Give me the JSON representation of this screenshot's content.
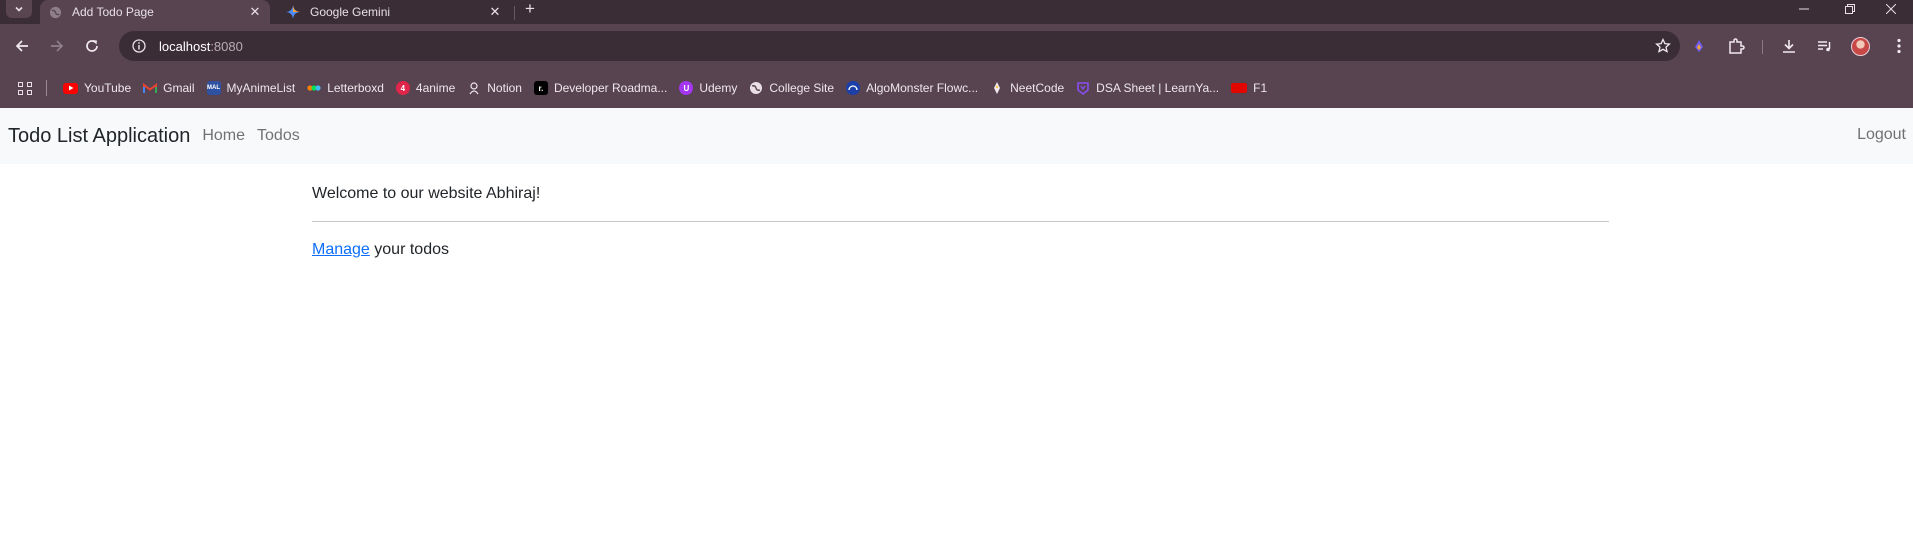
{
  "browser": {
    "tabs": [
      {
        "title": "Add Todo Page",
        "icon": "globe-icon",
        "active": true
      },
      {
        "title": "Google Gemini",
        "icon": "gemini-icon",
        "active": false
      }
    ],
    "address": {
      "host": "localhost",
      "port": ":8080"
    },
    "bookmarks": [
      {
        "label": "YouTube",
        "icon": "youtube-icon",
        "color": "#ff0000"
      },
      {
        "label": "Gmail",
        "icon": "gmail-icon",
        "color": "#ea4335"
      },
      {
        "label": "MyAnimeList",
        "icon": "myanimelist-icon",
        "color": "#2e51a2",
        "glyph": "MAL"
      },
      {
        "label": "Letterboxd",
        "icon": "letterboxd-icon",
        "color": "#00e054"
      },
      {
        "label": "4anime",
        "icon": "4anime-icon",
        "color": "#e0254a",
        "glyph": "4"
      },
      {
        "label": "Notion",
        "icon": "notion-icon",
        "color": "#ffffff"
      },
      {
        "label": "Developer Roadma...",
        "icon": "roadmap-icon",
        "color": "#000000"
      },
      {
        "label": "Udemy",
        "icon": "udemy-icon",
        "color": "#a435f0"
      },
      {
        "label": "College Site",
        "icon": "globe-icon",
        "color": "#e9dfe5"
      },
      {
        "label": "AlgoMonster Flowc...",
        "icon": "algomonster-icon",
        "color": "#1c3faa"
      },
      {
        "label": "NeetCode",
        "icon": "neetcode-icon",
        "color": "#f6c945"
      },
      {
        "label": "DSA Sheet | LearnYa...",
        "icon": "learnyard-icon",
        "color": "#8a4df1"
      },
      {
        "label": "F1",
        "icon": "f1-icon",
        "color": "#e10600"
      }
    ]
  },
  "app": {
    "brand": "Todo List Application",
    "nav": {
      "home": "Home",
      "todos": "Todos",
      "logout": "Logout"
    },
    "welcome": "Welcome to our website Abhiraj!",
    "manage_link": "Manage",
    "manage_suffix": " your todos"
  }
}
